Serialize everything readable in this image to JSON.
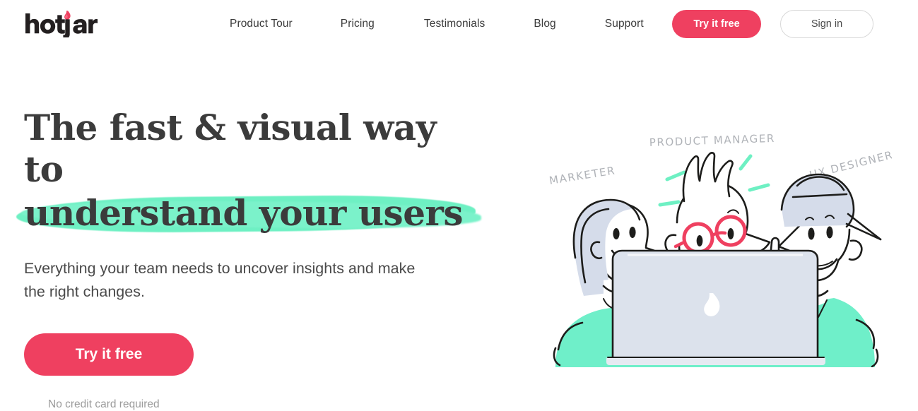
{
  "header": {
    "logo": {
      "name": "hotjar",
      "text_dark": "#231f20",
      "flame_color": "#ef4060"
    },
    "nav": [
      {
        "label": "Product Tour"
      },
      {
        "label": "Pricing"
      },
      {
        "label": "Testimonials"
      },
      {
        "label": "Blog"
      },
      {
        "label": "Support"
      }
    ],
    "actions": {
      "try_free_label": "Try it free",
      "sign_in_label": "Sign in"
    }
  },
  "hero": {
    "headline_line1": "The fast & visual way",
    "headline_line2_prefix": "to ",
    "headline_line2_highlight": "understand your users",
    "subheadline": "Everything your team needs to uncover insights and make the right changes.",
    "cta_label": "Try it free",
    "no_card_note": "No credit card required"
  },
  "illustration": {
    "alt": "three-people-at-laptop-illustration",
    "labels": [
      {
        "text": "MARKETER"
      },
      {
        "text": "PRODUCT MANAGER"
      },
      {
        "text": "UX DESIGNER"
      }
    ],
    "laptop_logo": "hotjar-flame-icon"
  },
  "colors": {
    "brand_pink": "#ef4060",
    "highlight_mint": "#6ef0c3",
    "shirt_mint": "#6fefc9",
    "laptop_gray": "#dce2ec",
    "hair_gray": "#d5dcea",
    "text_dark": "#3b3b3b",
    "text_muted": "#9b9b9b",
    "sketch_label_gray": "#b0b3b8",
    "page_background": "#ffffff"
  }
}
